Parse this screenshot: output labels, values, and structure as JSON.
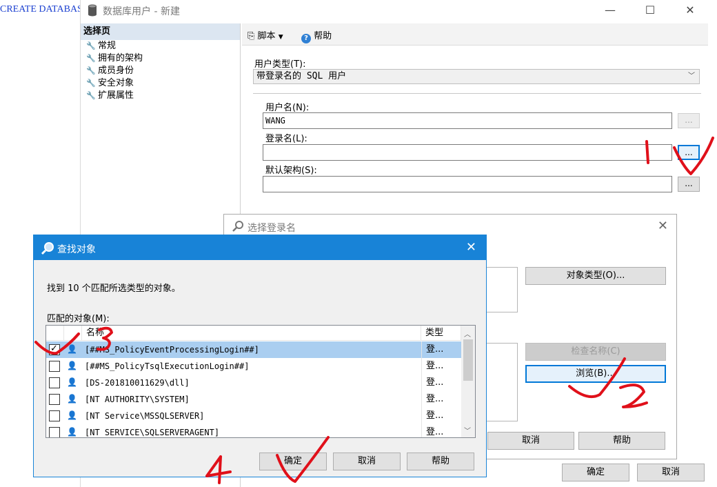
{
  "background": {
    "code_text": "CREATE DATABASE"
  },
  "main_window": {
    "title": "数据库用户 - 新建",
    "select_page_header": "选择页",
    "pages": [
      "常规",
      "拥有的架构",
      "成员身份",
      "安全对象",
      "扩展属性"
    ],
    "toolbar": {
      "script_label": "脚本",
      "help_label": "帮助"
    },
    "user_type_label": "用户类型(T):",
    "user_type_value": "带登录名的 SQL 用户",
    "username_label": "用户名(N):",
    "username_value": "WANG",
    "login_label": "登录名(L):",
    "login_value": "",
    "schema_label": "默认架构(S):",
    "schema_value": "",
    "browse_dots": "...",
    "ok_label": "确定",
    "cancel_label": "取消"
  },
  "select_login": {
    "title": "选择登录名",
    "object_types_button": "对象类型(O)...",
    "check_names_button": "检查名称(C)",
    "browse_button": "浏览(B)...",
    "cancel_button": "取消",
    "help_button": "帮助"
  },
  "find_objects": {
    "title": "查找对象",
    "found_text": "找到 10 个匹配所选类型的对象。",
    "matched_label": "匹配的对象(M):",
    "columns": {
      "name": "名称",
      "type": "类型"
    },
    "rows": [
      {
        "name": "[##MS_PolicyEventProcessingLogin##]",
        "type": "登...",
        "checked": true,
        "selected": true
      },
      {
        "name": "[##MS_PolicyTsqlExecutionLogin##]",
        "type": "登...",
        "checked": false,
        "selected": false
      },
      {
        "name": "[DS-201810011629\\dll]",
        "type": "登...",
        "checked": false,
        "selected": false
      },
      {
        "name": "[NT AUTHORITY\\SYSTEM]",
        "type": "登...",
        "checked": false,
        "selected": false
      },
      {
        "name": "[NT Service\\MSSQLSERVER]",
        "type": "登...",
        "checked": false,
        "selected": false
      },
      {
        "name": "[NT SERVICE\\SQLSERVERAGENT]",
        "type": "登...",
        "checked": false,
        "selected": false
      }
    ],
    "ok_button": "确定",
    "cancel_button": "取消",
    "help_button": "帮助"
  },
  "annotations": [
    "1",
    "2",
    "3",
    "4"
  ],
  "colors": {
    "accent": "#1883d7",
    "selection": "#aacef0",
    "annotation": "#e0101a"
  }
}
